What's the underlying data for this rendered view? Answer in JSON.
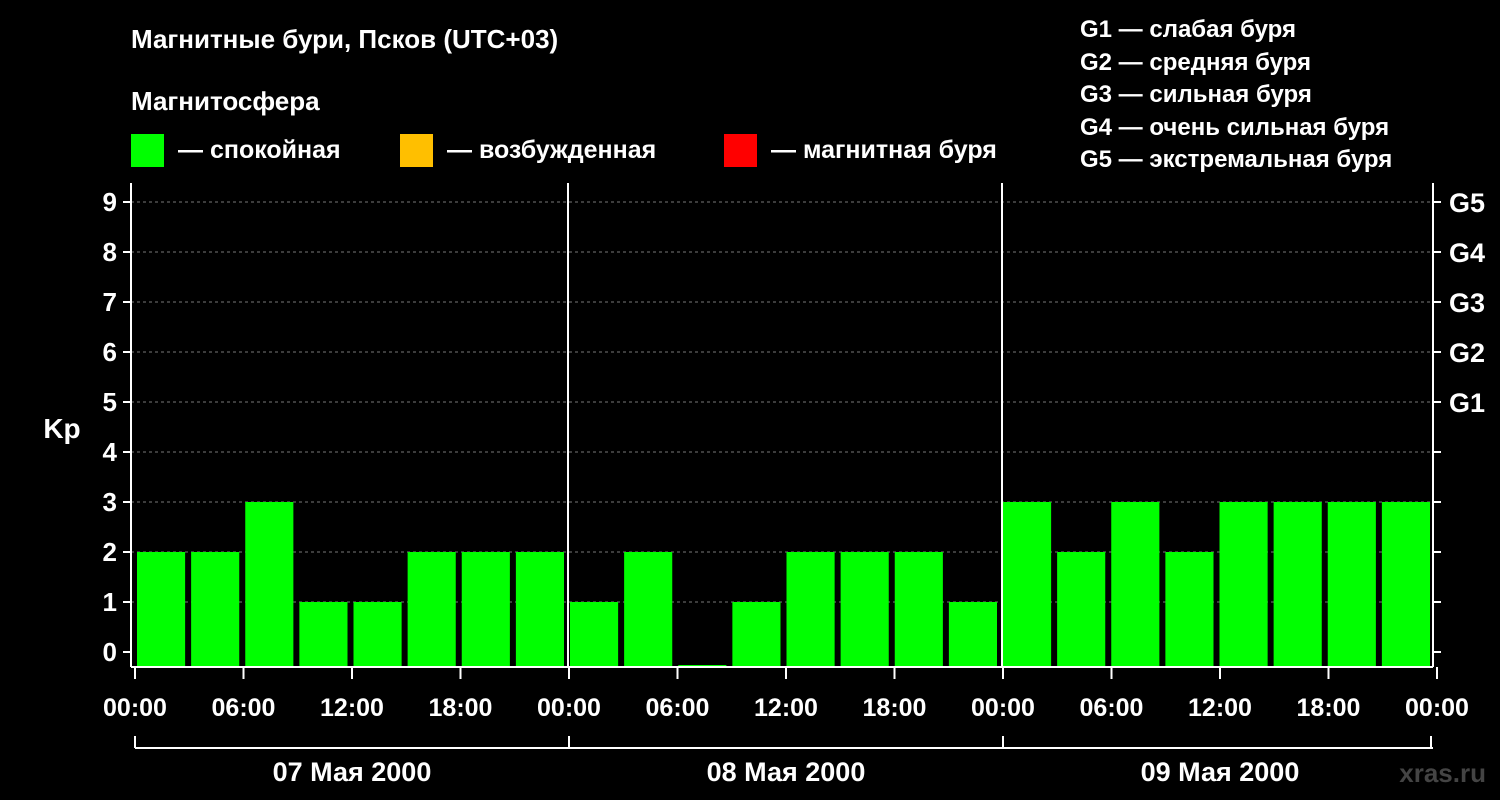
{
  "title": "Магнитные бури, Псков (UTC+03)",
  "subtitle": "Магнитосфера",
  "legend": [
    {
      "label": "— спокойная",
      "color": "#00ff00"
    },
    {
      "label": "— возбужденная",
      "color": "#ffbf00"
    },
    {
      "label": "— магнитная буря",
      "color": "#ff0000"
    }
  ],
  "g_legend": [
    "G1 — слабая буря",
    "G2 — средняя буря",
    "G3 — сильная буря",
    "G4 — очень сильная буря",
    "G5 — экстремальная буря"
  ],
  "watermark": "xras.ru",
  "chart_data": {
    "type": "bar",
    "ylabel": "Kp",
    "ylim": [
      0,
      9
    ],
    "y_ticks": [
      "0",
      "1",
      "2",
      "3",
      "4",
      "5",
      "6",
      "7",
      "8",
      "9"
    ],
    "right_ticks": [
      {
        "value": 5,
        "label": "G1"
      },
      {
        "value": 6,
        "label": "G2"
      },
      {
        "value": 7,
        "label": "G3"
      },
      {
        "value": 8,
        "label": "G4"
      },
      {
        "value": 9,
        "label": "G5"
      }
    ],
    "x_tick_labels": [
      "00:00",
      "06:00",
      "12:00",
      "18:00",
      "00:00",
      "06:00",
      "12:00",
      "18:00",
      "00:00",
      "06:00",
      "12:00",
      "18:00",
      "00:00"
    ],
    "days": [
      "07 Мая 2000",
      "08 Мая 2000",
      "09 Мая 2000"
    ],
    "values": [
      2,
      2,
      3,
      1,
      1,
      2,
      2,
      2,
      1,
      2,
      0,
      1,
      2,
      2,
      2,
      1,
      3,
      2,
      3,
      2,
      3,
      3,
      3,
      3
    ],
    "bar_color": "#00ff00",
    "grid": true
  }
}
